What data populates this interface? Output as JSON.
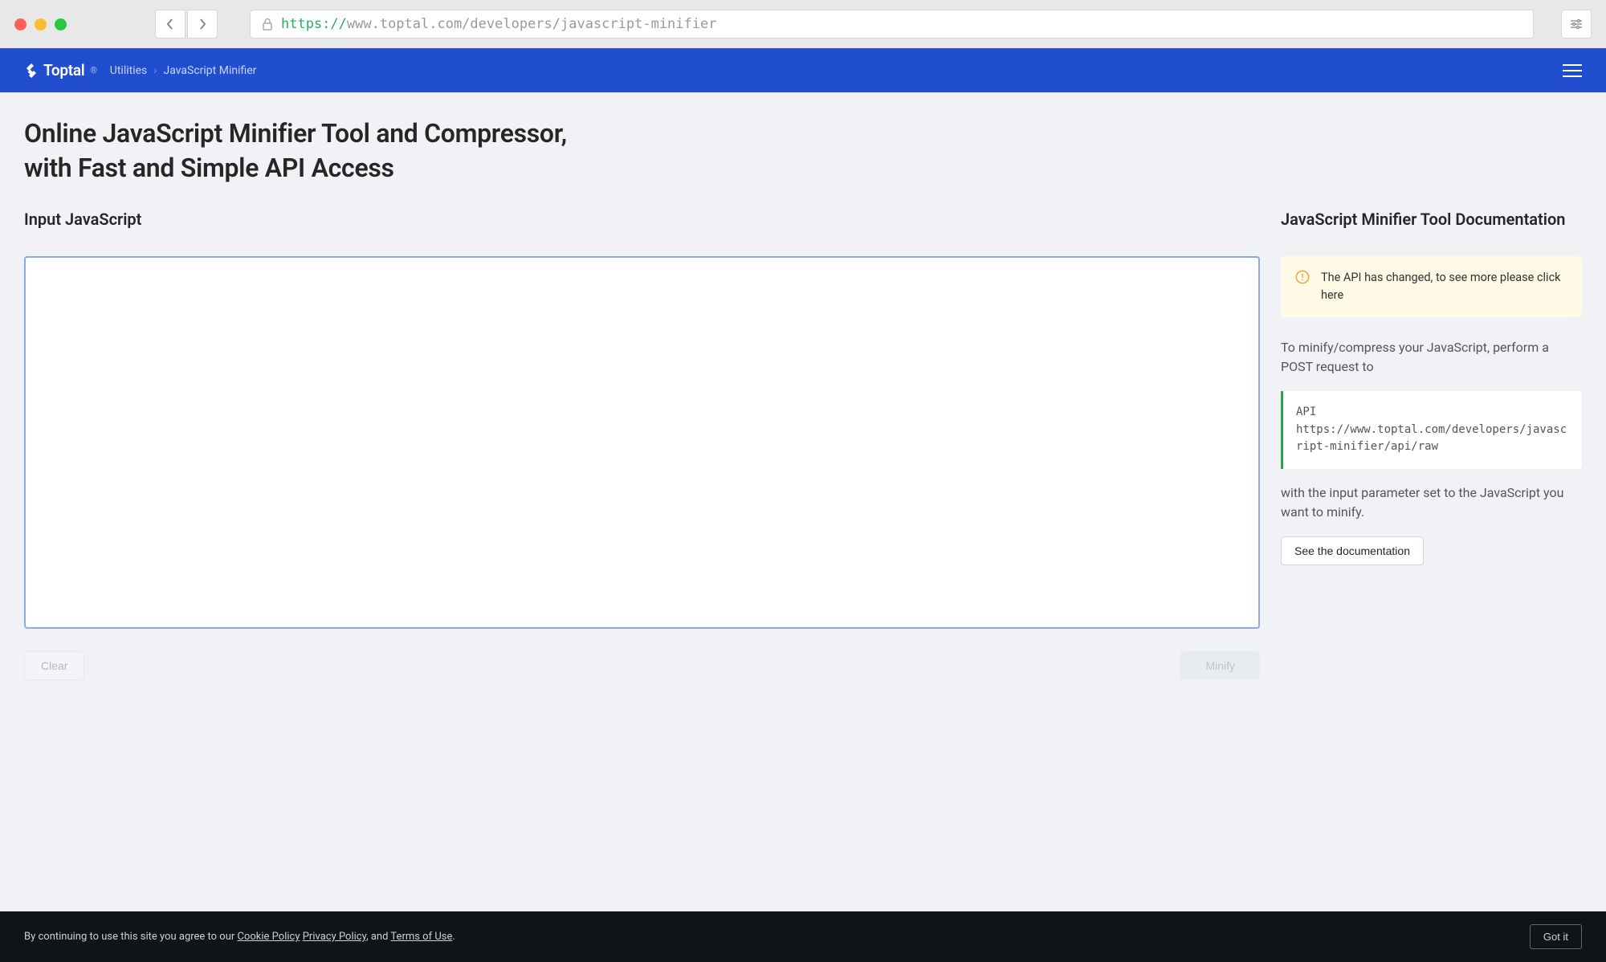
{
  "browser": {
    "url_protocol": "https://",
    "url_rest": "www.toptal.com/developers/javascript-minifier"
  },
  "header": {
    "logo_text": "Toptal",
    "breadcrumb": {
      "utilities": "Utilities",
      "current": "JavaScript Minifier"
    }
  },
  "main": {
    "title": "Online JavaScript Minifier Tool and Compressor, with Fast and Simple API Access",
    "input_heading": "Input JavaScript",
    "textarea_value": "",
    "clear_label": "Clear",
    "minify_label": "Minify"
  },
  "sidebar": {
    "heading": "JavaScript Minifier Tool Documentation",
    "notice_text": "The API has changed, to see more please click ",
    "notice_link": "here",
    "para1": "To minify/compress your JavaScript, perform a POST request to",
    "api_label": "API",
    "api_url": "https://www.toptal.com/developers/javascript-minifier/api/raw",
    "para2": "with the input parameter set to the JavaScript you want to minify.",
    "docs_button": "See the documentation"
  },
  "cookie": {
    "prefix": "By continuing to use this site you agree to our ",
    "cookie_policy": "Cookie Policy",
    "privacy_policy": "Privacy Policy",
    "and": ", and ",
    "terms": "Terms of Use",
    "suffix": ".",
    "got_it": "Got it"
  }
}
